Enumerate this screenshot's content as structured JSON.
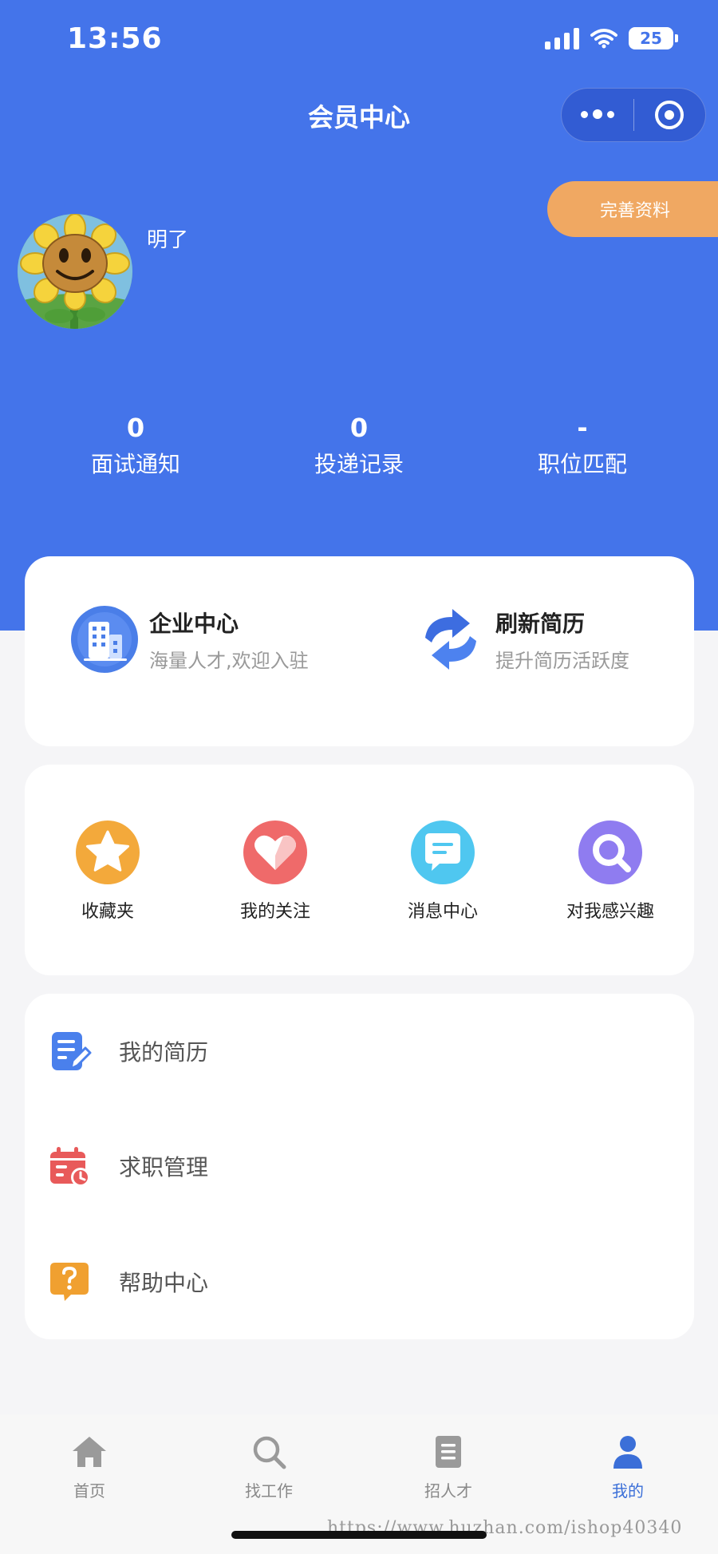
{
  "status_bar": {
    "time": "13:56",
    "battery": "25"
  },
  "nav": {
    "title": "会员中心"
  },
  "profile": {
    "name": "明了",
    "complete_button": "完善资料"
  },
  "stats": [
    {
      "value": "0",
      "label": "面试通知"
    },
    {
      "value": "0",
      "label": "投递记录"
    },
    {
      "value": "-",
      "label": "职位匹配"
    }
  ],
  "features": [
    {
      "title": "企业中心",
      "subtitle": "海量人才,欢迎入驻",
      "icon": "building-icon"
    },
    {
      "title": "刷新简历",
      "subtitle": "提升简历活跃度",
      "icon": "refresh-icon"
    }
  ],
  "quick_actions": [
    {
      "label": "收藏夹",
      "icon": "star-icon",
      "color": "#f3a93b"
    },
    {
      "label": "我的关注",
      "icon": "heart-icon",
      "color": "#ef6a6a"
    },
    {
      "label": "消息中心",
      "icon": "message-icon",
      "color": "#4fc7f0"
    },
    {
      "label": "对我感兴趣",
      "icon": "search-icon",
      "color": "#8f7cf0"
    }
  ],
  "menu": [
    {
      "label": "我的简历",
      "icon": "resume-icon",
      "color": "#4a80ec"
    },
    {
      "label": "求职管理",
      "icon": "calendar-icon",
      "color": "#e85a5a"
    },
    {
      "label": "帮助中心",
      "icon": "help-icon",
      "color": "#f0a030"
    }
  ],
  "tabbar": [
    {
      "label": "首页",
      "icon": "home-icon",
      "active": false
    },
    {
      "label": "找工作",
      "icon": "search-icon",
      "active": false
    },
    {
      "label": "招人才",
      "icon": "document-icon",
      "active": false
    },
    {
      "label": "我的",
      "icon": "user-icon",
      "active": true
    }
  ],
  "colors": {
    "primary": "#4474ea",
    "accent": "#f0a862",
    "active_tab": "#3b6fd8"
  },
  "watermark": "https://www.huzhan.com/ishop40340"
}
